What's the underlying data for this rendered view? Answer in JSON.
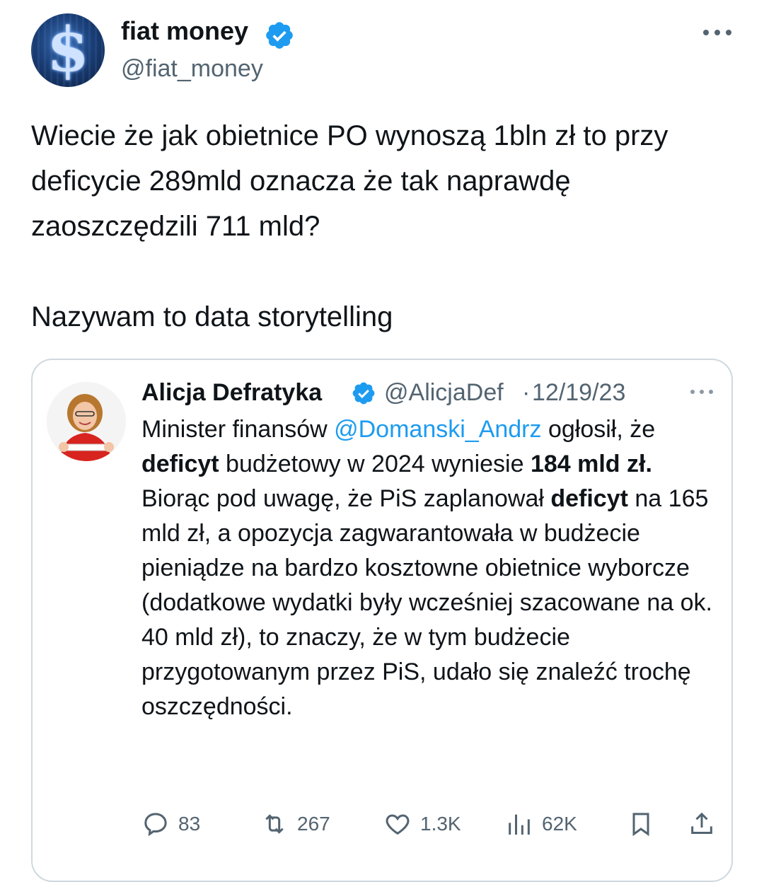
{
  "author": {
    "display_name": "fiat money",
    "handle": "@fiat_money",
    "verified": true,
    "avatar_icon": "dollar-sign-avatar"
  },
  "tweet": {
    "paragraph1": "Wiecie że jak obietnice PO wynoszą 1bln zł to przy deficycie 289mld oznacza że tak naprawdę zaoszczędzili 711 mld?",
    "paragraph2": "Nazywam to data storytelling"
  },
  "quoted": {
    "display_name": "Alicja Defratyka",
    "handle": "@AlicjaDef",
    "separator": "·",
    "date": "12/19/23",
    "verified": true,
    "body": {
      "t1": "Minister finansów ",
      "mention": "@Domanski_Andrz",
      "t2": " ogłosił, że ",
      "b1": "deficyt",
      "t3": " budżetowy w 2024 wyniesie ",
      "b2": "184 mld zł.",
      "t4": "Biorąc pod uwagę, że PiS zaplanował ",
      "b3": "deficyt",
      "t5": " na 165 mld zł, a opozycja zagwarantowała w budżecie pieniądze na bardzo kosztowne obietnice wyborcze (dodatkowe wydatki były wcześniej szacowane na ok. 40 mld zł), to znaczy, że w tym budżecie przygotowanym przez PiS, udało się znaleźć trochę oszczędności."
    },
    "actions": {
      "replies": "83",
      "reposts": "267",
      "likes": "1.3K",
      "views": "62K"
    }
  },
  "colors": {
    "accent": "#1d9bf0",
    "text": "#0f1419",
    "secondary": "#536471",
    "border": "#cfd9de"
  }
}
